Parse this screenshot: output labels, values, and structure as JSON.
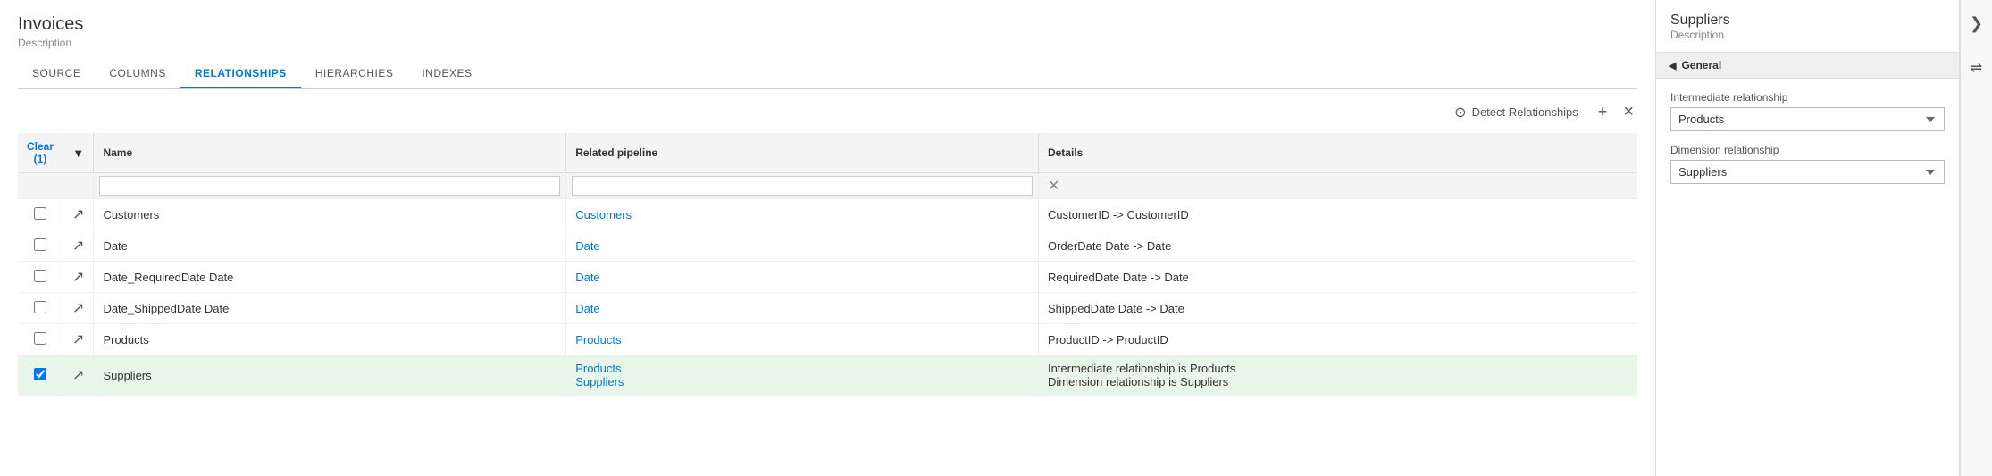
{
  "page": {
    "title": "Invoices",
    "description": "Description"
  },
  "tabs": [
    {
      "id": "source",
      "label": "SOURCE",
      "active": false
    },
    {
      "id": "columns",
      "label": "COLUMNS",
      "active": false
    },
    {
      "id": "relationships",
      "label": "RELATIONSHIPS",
      "active": true
    },
    {
      "id": "hierarchies",
      "label": "HIERARCHIES",
      "active": false
    },
    {
      "id": "indexes",
      "label": "INDEXES",
      "active": false
    }
  ],
  "toolbar": {
    "detect_label": "Detect Relationships",
    "add_label": "+",
    "remove_label": "×"
  },
  "table": {
    "clear_label": "Clear (1)",
    "columns": [
      {
        "id": "name",
        "label": "Name"
      },
      {
        "id": "related_pipeline",
        "label": "Related pipeline"
      },
      {
        "id": "details",
        "label": "Details"
      }
    ],
    "rows": [
      {
        "id": 1,
        "checked": false,
        "selected": false,
        "name": "Customers",
        "related_pipeline": "Customers",
        "details": "CustomerID -> CustomerID"
      },
      {
        "id": 2,
        "checked": false,
        "selected": false,
        "name": "Date",
        "related_pipeline": "Date",
        "details": "OrderDate Date -> Date"
      },
      {
        "id": 3,
        "checked": false,
        "selected": false,
        "name": "Date_RequiredDate Date",
        "related_pipeline": "Date",
        "details": "RequiredDate Date -> Date"
      },
      {
        "id": 4,
        "checked": false,
        "selected": false,
        "name": "Date_ShippedDate Date",
        "related_pipeline": "Date",
        "details": "ShippedDate Date -> Date"
      },
      {
        "id": 5,
        "checked": false,
        "selected": false,
        "name": "Products",
        "related_pipeline": "Products",
        "details": "ProductID -> ProductID"
      },
      {
        "id": 6,
        "checked": true,
        "selected": true,
        "name": "Suppliers",
        "related_pipeline_lines": [
          "Products",
          "Suppliers"
        ],
        "details_lines": [
          "Intermediate relationship is Products",
          "Dimension relationship is Suppliers"
        ]
      }
    ]
  },
  "right_panel": {
    "title": "Suppliers",
    "description": "Description",
    "section_label": "General",
    "intermediate_relationship_label": "Intermediate relationship",
    "intermediate_relationship_value": "Products",
    "dimension_relationship_label": "Dimension relationship",
    "dimension_relationship_value": "Suppliers",
    "dropdown_options_intermediate": [
      "Products"
    ],
    "dropdown_options_dimension": [
      "Suppliers"
    ]
  },
  "side_icons": {
    "collapse_icon": "❯",
    "settings_icon": "⇌"
  }
}
